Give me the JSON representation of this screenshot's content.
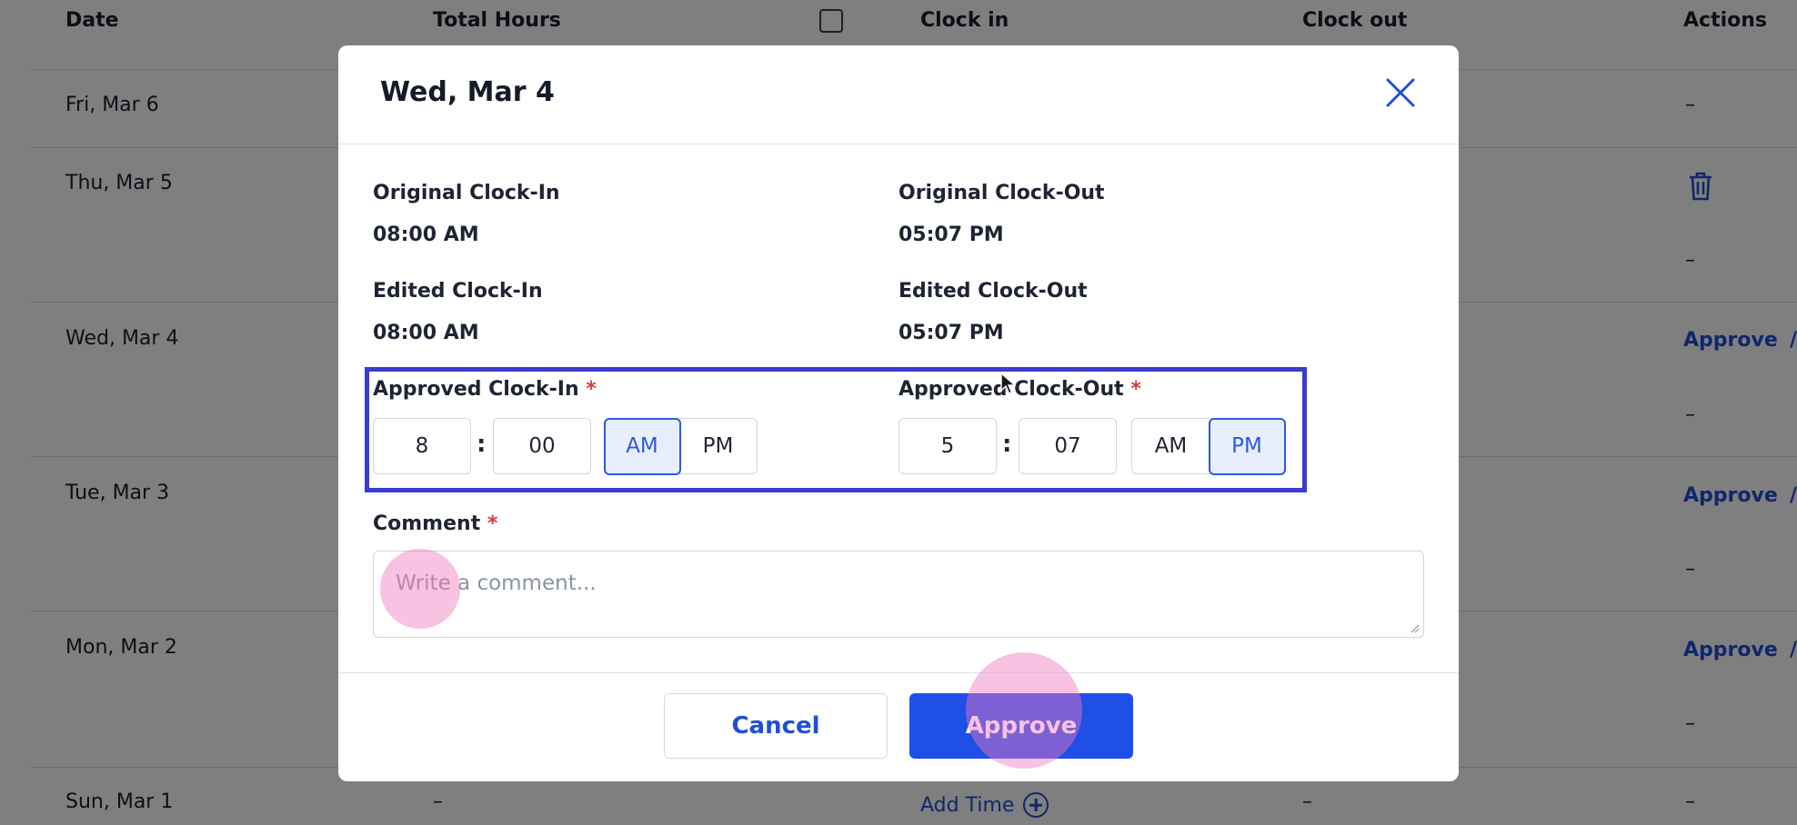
{
  "table": {
    "headers": {
      "date": "Date",
      "total_hours": "Total Hours",
      "clock_in": "Clock in",
      "clock_out": "Clock out",
      "actions": "Actions"
    },
    "rows": [
      {
        "date": "Fri, Mar 6",
        "action_dash": "–"
      },
      {
        "date": "Thu, Mar 5",
        "action_dash": "–"
      },
      {
        "date": "Wed, Mar 4",
        "action": "Approve",
        "action_dash": "–"
      },
      {
        "date": "Tue, Mar 3",
        "action": "Approve",
        "action_dash": "–"
      },
      {
        "date": "Mon, Mar 2",
        "action": "Approve",
        "action_dash": "–"
      },
      {
        "date": "Sun, Mar 1",
        "total_hours": "–",
        "clock_in_link": "Add Time",
        "clock_out": "–",
        "action_dash": "–"
      }
    ],
    "cut_mark": "/"
  },
  "modal": {
    "title": "Wed, Mar 4",
    "original_clock_in_label": "Original Clock-In",
    "original_clock_in_value": "08:00 AM",
    "original_clock_out_label": "Original Clock-Out",
    "original_clock_out_value": "05:07 PM",
    "edited_clock_in_label": "Edited Clock-In",
    "edited_clock_in_value": "08:00 AM",
    "edited_clock_out_label": "Edited Clock-Out",
    "edited_clock_out_value": "05:07 PM",
    "approved_clock_in_label": "Approved Clock-In",
    "approved_clock_out_label": "Approved Clock-Out",
    "required_mark": "*",
    "colon": ":",
    "approved_in": {
      "hour": "8",
      "minute": "00",
      "am": "AM",
      "pm": "PM",
      "selected": "AM"
    },
    "approved_out": {
      "hour": "5",
      "minute": "07",
      "am": "AM",
      "pm": "PM",
      "selected": "PM"
    },
    "comment_label": "Comment",
    "comment_placeholder": "Write a comment...",
    "cancel_label": "Cancel",
    "approve_label": "Approve"
  },
  "colors": {
    "accent": "#1f4fe6",
    "highlight_border": "#3b3bd1",
    "required": "#d93a3a"
  }
}
